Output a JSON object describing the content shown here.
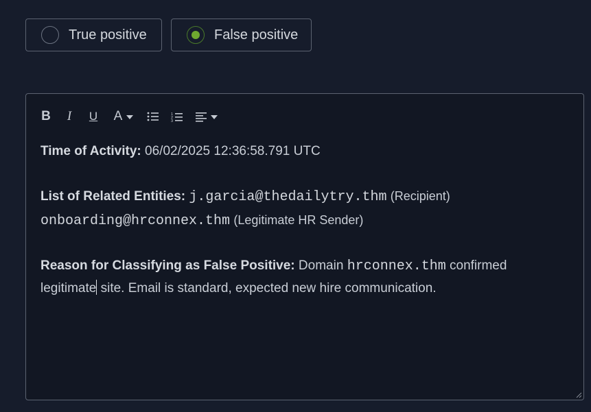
{
  "classification": {
    "options": [
      {
        "label": "True positive",
        "selected": false
      },
      {
        "label": "False positive",
        "selected": true
      }
    ],
    "accent_color": "#6fa82f"
  },
  "editor": {
    "toolbar": {
      "bold": "B",
      "italic": "I",
      "underline": "U",
      "font_color": "A",
      "icons": [
        "bold-icon",
        "italic-icon",
        "underline-icon",
        "font-color-icon",
        "bullet-list-icon",
        "numbered-list-icon",
        "align-left-icon"
      ]
    },
    "content": {
      "time_label": "Time of Activity:",
      "time_value": "06/02/2025 12:36:58.791 UTC",
      "entities_label": "List of Related Entities:",
      "entity1_email": "j.garcia@thedailytry.thm",
      "entity1_role": "(Recipient)",
      "entity2_email": "onboarding@hrconnex.thm",
      "entity2_role": "(Legitimate HR Sender)",
      "reason_label": "Reason for Classifying as False Positive:",
      "reason_part1": "Domain",
      "reason_domain": "hrconnex.thm",
      "reason_part2": "confirmed",
      "reason_line2_a": "legitimate",
      "reason_line2_b": " site. Email is standard, expected new hire communication."
    }
  }
}
